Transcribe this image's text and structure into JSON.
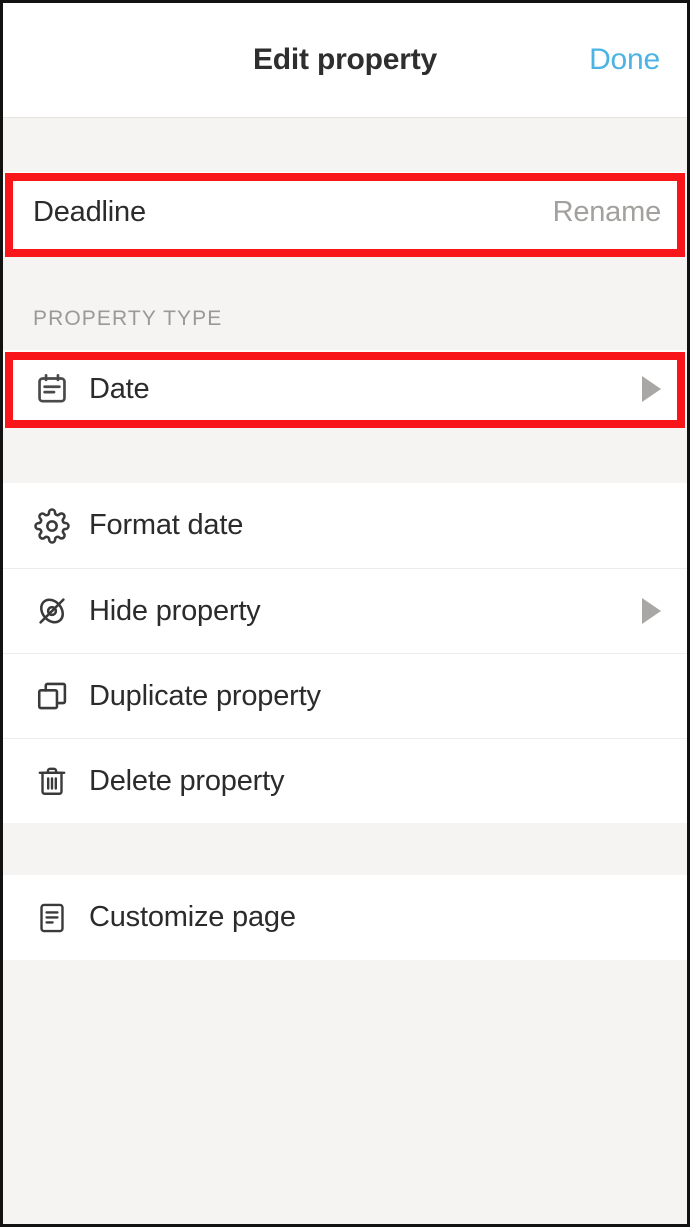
{
  "header": {
    "title": "Edit property",
    "done_label": "Done",
    "done_color": "#4cb3e4"
  },
  "name_row": {
    "label": "Deadline",
    "action_label": "Rename",
    "icon": "none"
  },
  "property_type_section": {
    "section_label": "PROPERTY TYPE",
    "row": {
      "label": "Date",
      "icon": "calendar-icon",
      "has_chevron": true
    }
  },
  "actions": [
    {
      "label": "Format date",
      "icon": "gear-icon",
      "has_chevron": false
    },
    {
      "label": "Hide property",
      "icon": "eye-off-icon",
      "has_chevron": true
    },
    {
      "label": "Duplicate property",
      "icon": "duplicate-icon",
      "has_chevron": false
    },
    {
      "label": "Delete property",
      "icon": "trash-icon",
      "has_chevron": false
    }
  ],
  "page_actions": [
    {
      "label": "Customize page",
      "icon": "document-icon",
      "has_chevron": false
    }
  ],
  "annotations": {
    "color": "#f8161b",
    "boxes": [
      {
        "target": "name-row"
      },
      {
        "target": "property-type-row"
      }
    ]
  }
}
